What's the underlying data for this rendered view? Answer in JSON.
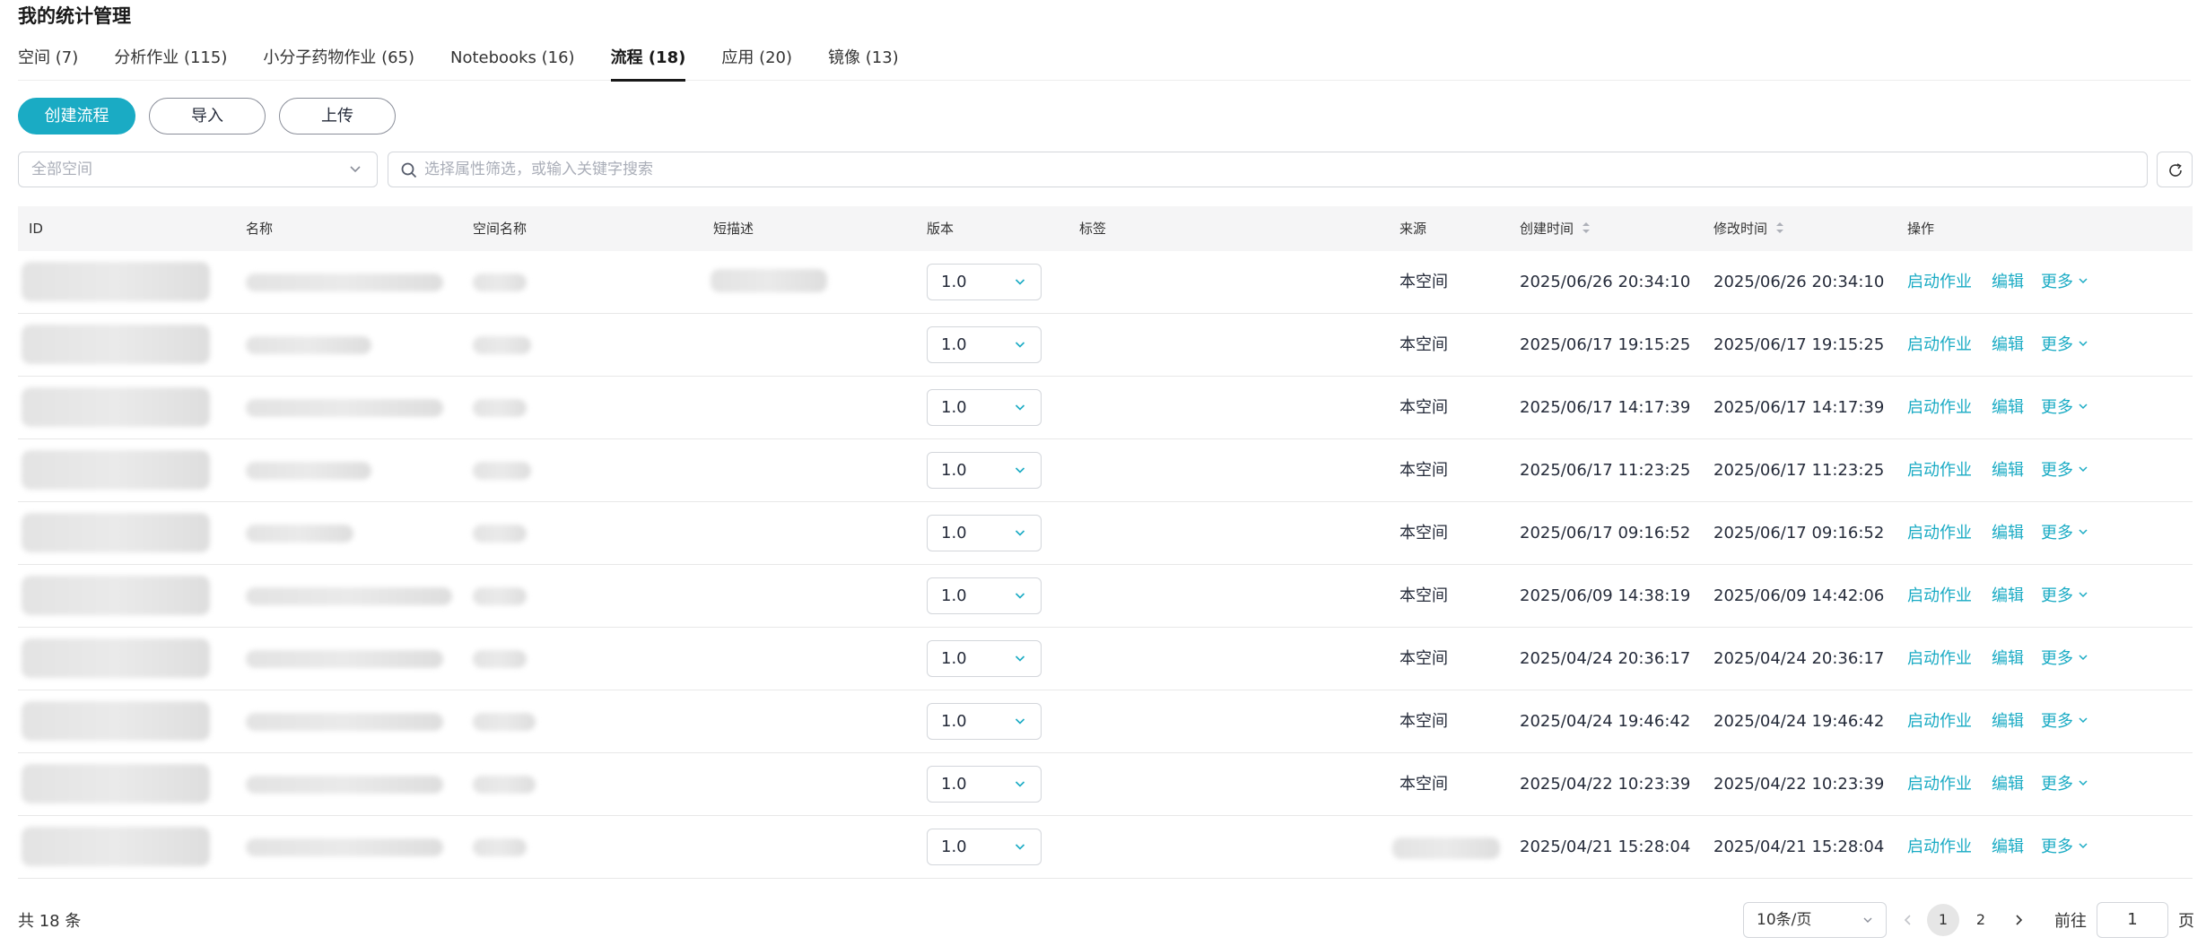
{
  "page": {
    "title": "我的统计管理"
  },
  "tabs": [
    {
      "label": "空间 (7)",
      "active": false
    },
    {
      "label": "分析作业 (115)",
      "active": false
    },
    {
      "label": "小分子药物作业 (65)",
      "active": false
    },
    {
      "label": "Notebooks (16)",
      "active": false
    },
    {
      "label": "流程 (18)",
      "active": true
    },
    {
      "label": "应用 (20)",
      "active": false
    },
    {
      "label": "镜像 (13)",
      "active": false
    }
  ],
  "toolbar": {
    "create_label": "创建流程",
    "import_label": "导入",
    "upload_label": "上传"
  },
  "filter": {
    "space_placeholder": "全部空间",
    "search_placeholder": "选择属性筛选，或输入关键字搜索"
  },
  "table": {
    "columns": {
      "id": "ID",
      "name": "名称",
      "space": "空间名称",
      "desc": "短描述",
      "version": "版本",
      "tags": "标签",
      "source": "来源",
      "created": "创建时间",
      "modified": "修改时间",
      "actions": "操作"
    },
    "action_labels": {
      "start": "启动作业",
      "edit": "编辑",
      "more": "更多"
    },
    "rows": [
      {
        "version": "1.0",
        "source": "本空间",
        "created": "2025/06/26 20:34:10",
        "modified": "2025/06/26 20:34:10"
      },
      {
        "version": "1.0",
        "source": "本空间",
        "created": "2025/06/17 19:15:25",
        "modified": "2025/06/17 19:15:25"
      },
      {
        "version": "1.0",
        "source": "本空间",
        "created": "2025/06/17 14:17:39",
        "modified": "2025/06/17 14:17:39"
      },
      {
        "version": "1.0",
        "source": "本空间",
        "created": "2025/06/17 11:23:25",
        "modified": "2025/06/17 11:23:25"
      },
      {
        "version": "1.0",
        "source": "本空间",
        "created": "2025/06/17 09:16:52",
        "modified": "2025/06/17 09:16:52"
      },
      {
        "version": "1.0",
        "source": "本空间",
        "created": "2025/06/09 14:38:19",
        "modified": "2025/06/09 14:42:06"
      },
      {
        "version": "1.0",
        "source": "本空间",
        "created": "2025/04/24 20:36:17",
        "modified": "2025/04/24 20:36:17"
      },
      {
        "version": "1.0",
        "source": "本空间",
        "created": "2025/04/24 19:46:42",
        "modified": "2025/04/24 19:46:42"
      },
      {
        "version": "1.0",
        "source": "本空间",
        "created": "2025/04/22 10:23:39",
        "modified": "2025/04/22 10:23:39"
      },
      {
        "version": "1.0",
        "source": "",
        "created": "2025/04/21 15:28:04",
        "modified": "2025/04/21 15:28:04"
      }
    ]
  },
  "pagination": {
    "total": "共 18 条",
    "page_size": "10条/页",
    "pages": [
      "1",
      "2"
    ],
    "current": "1",
    "goto_label": "前往",
    "goto_value": "1",
    "page_unit": "页"
  }
}
